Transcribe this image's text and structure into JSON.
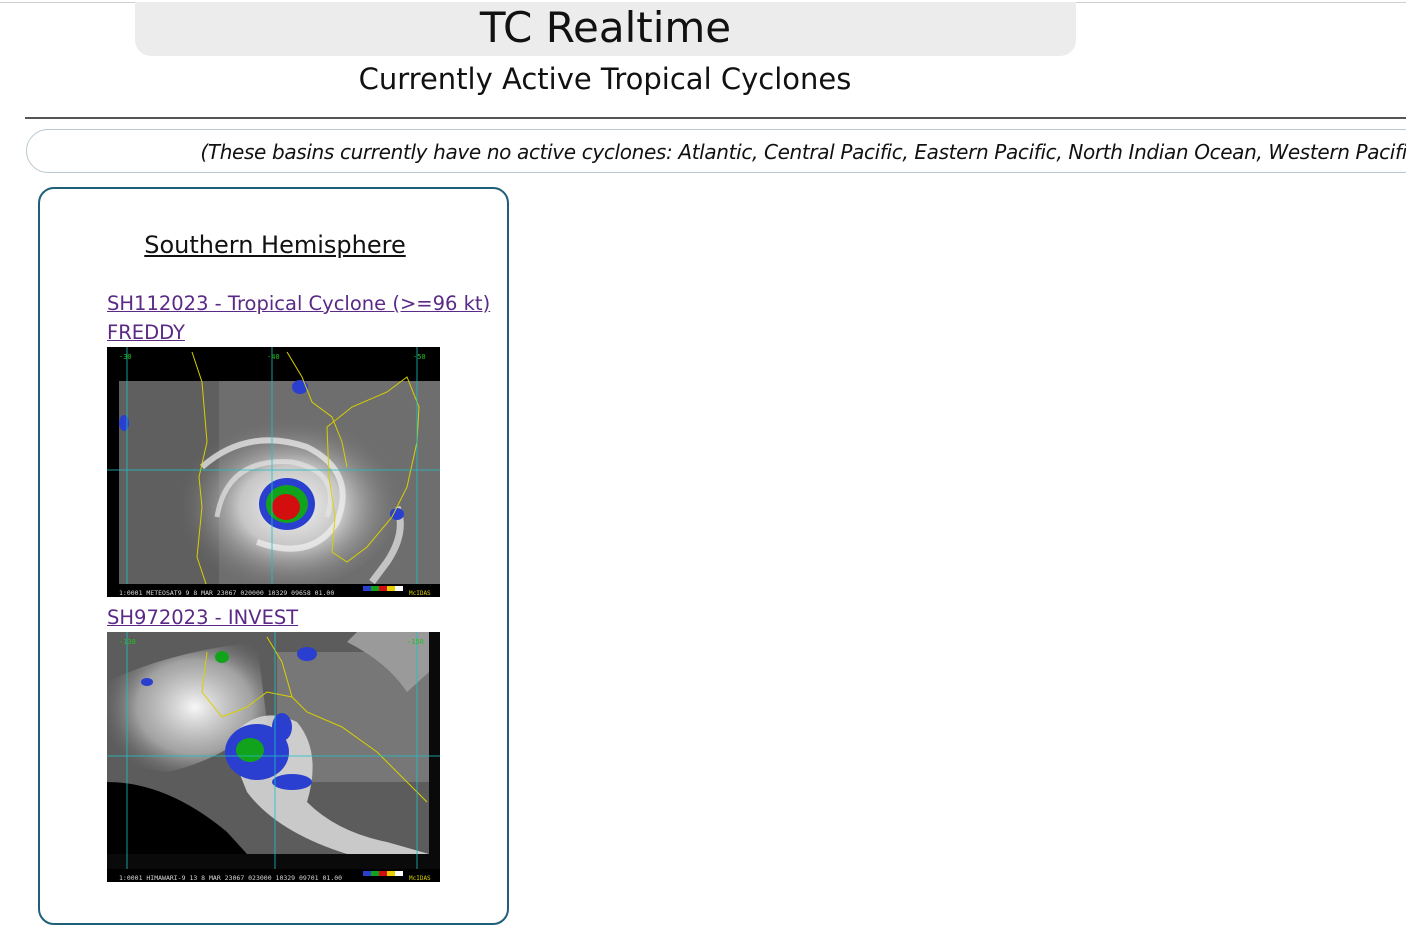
{
  "header": {
    "site_title": "TC Realtime",
    "subtitle": "Currently Active Tropical Cyclones"
  },
  "notice": {
    "inactive_basins_text": "(These basins currently have no active cyclones: Atlantic, Central Pacific, Eastern Pacific, North Indian Ocean, Western Pacific)"
  },
  "southern_hemisphere": {
    "title": "Southern Hemisphere",
    "storms": [
      {
        "id_line": "SH112023 - Tropical Cyclone (>=96 kt)",
        "name_line": "FREDDY",
        "image": {
          "caption": "1:0001 METEOSAT9   9  8 MAR 23067 020000 10329 09658 01.00",
          "brand": "McIDAS",
          "grid_labels": [
            "-30",
            "-40",
            "-50"
          ]
        }
      },
      {
        "id_line": "SH972023 - INVEST",
        "image": {
          "caption": "1:0001 HIMAWARI-9 13  8 MAR 23067 023000 10329 09701 01.00",
          "brand": "McIDAS",
          "grid_labels": [
            "-130",
            "-150"
          ]
        }
      }
    ]
  },
  "colors": {
    "link": "#5a2a86",
    "panel_border": "#1f5f7a",
    "title_bar_bg": "#ececec",
    "sat_land": "#d8d000",
    "sat_grid": "#20c0c0"
  }
}
